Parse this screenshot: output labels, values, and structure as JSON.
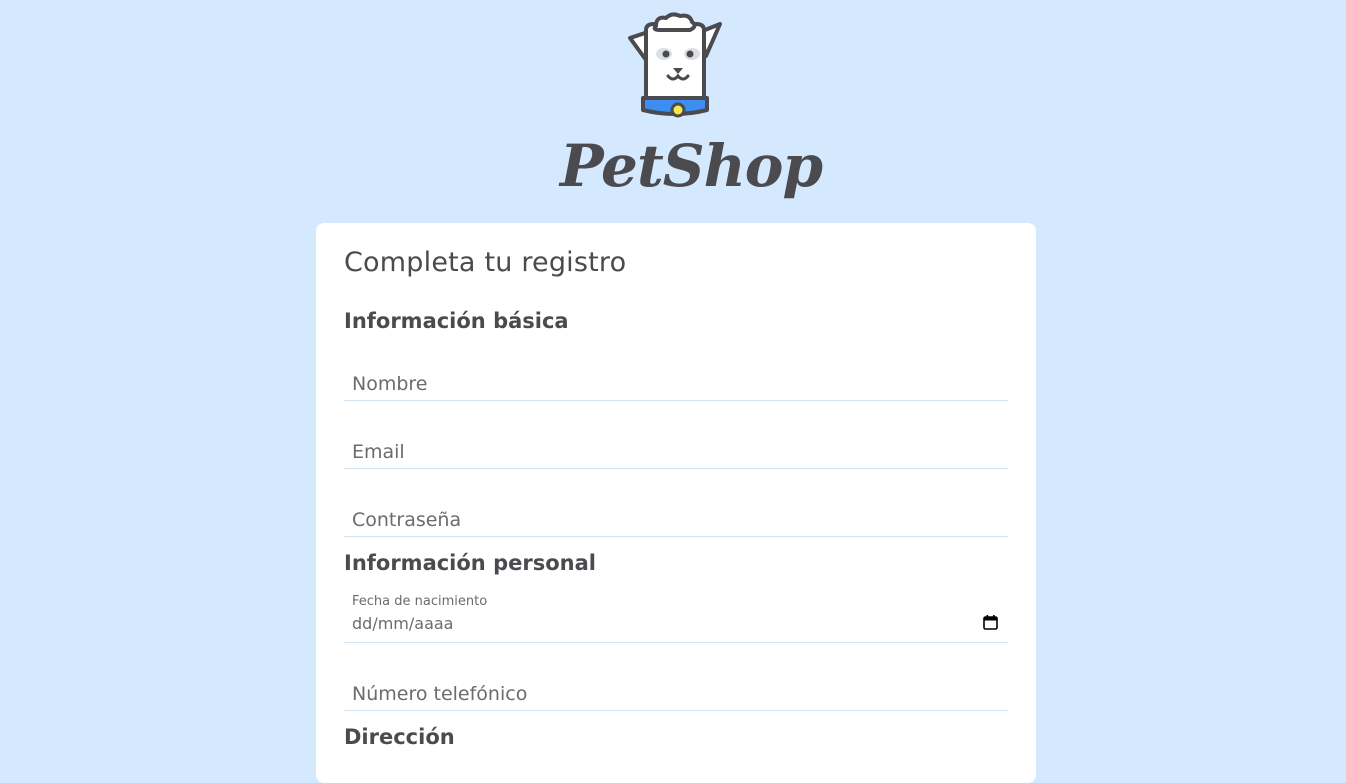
{
  "brand": {
    "name": "PetShop",
    "logo_icon": "dog-head-icon"
  },
  "form": {
    "title": "Completa tu registro",
    "sections": {
      "basic": {
        "title": "Información básica",
        "name_placeholder": "Nombre",
        "email_placeholder": "Email",
        "password_placeholder": "Contraseña"
      },
      "personal": {
        "title": "Información personal",
        "birthdate_label": "Fecha de nacimiento",
        "birthdate_value": "dd/mm/aaaa",
        "phone_placeholder": "Número telefónico"
      },
      "address": {
        "title": "Dirección"
      }
    }
  },
  "colors": {
    "background": "#d4e8fe",
    "card": "#ffffff",
    "text": "#4a4a4f",
    "input_border": "#cfe3f3",
    "collar": "#3d8ef0",
    "tag": "#f5e94a"
  }
}
